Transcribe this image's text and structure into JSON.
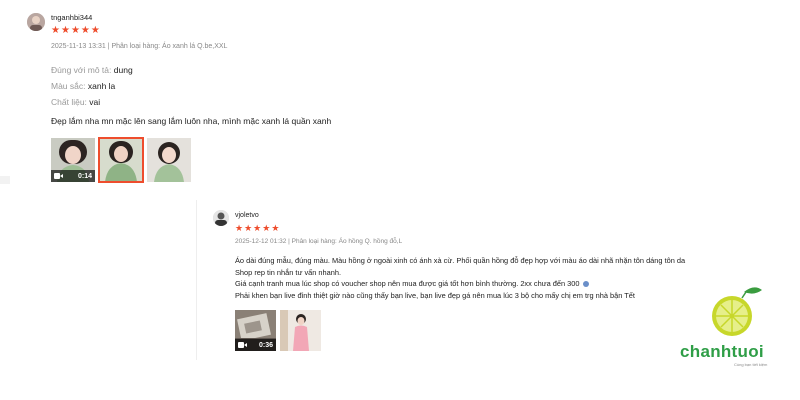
{
  "review1": {
    "username": "tnganhbi344",
    "rating": 5,
    "meta": "2025-11-13 13:31 | Phân loại hàng: Áo xanh lá Q.be,XXL",
    "attributes": [
      {
        "key": "Đúng với mô tả:",
        "value": "dung"
      },
      {
        "key": "Màu sắc:",
        "value": "xanh la"
      },
      {
        "key": "Chất liệu:",
        "value": "vai"
      }
    ],
    "comment": "Đẹp lắm nha mn mặc lên sang lắm luôn nha, mình mặc xanh lá quần xanh",
    "video_duration": "0:14"
  },
  "review2": {
    "username": "vjoletvo",
    "rating": 5,
    "meta": "2025-12-12 01:32 | Phân loại hàng: Áo hồng Q. hồng đỗ,L",
    "comment_lines": [
      "Áo dài đúng mẫu, đúng màu. Màu hồng ở ngoài xinh có ánh xà cừ. Phối quần hồng đỗ đẹp hợp với màu áo dài nhã nhặn tôn dáng tôn da",
      "Shop rep tin nhắn tư vấn nhanh.",
      "Giá cạnh tranh mua lúc shop có voucher shop nên mua được giá tốt hơn bình thường. 2xx chưa đến 300",
      "Phải khen bạn live đỉnh thiệt giờ nào cũng thấy bạn live, bạn live đẹp gá nên mua lúc 3 bộ cho mấy chị em trg nhà bận Tết"
    ],
    "video_duration": "0:36"
  },
  "logo": {
    "text": "chanhtuoi",
    "tagline": "Cùng bạn tiết kiệm"
  },
  "colors": {
    "star": "#ee4d2d",
    "brand_green": "#2f9e47",
    "lime": "#c7d72a"
  }
}
